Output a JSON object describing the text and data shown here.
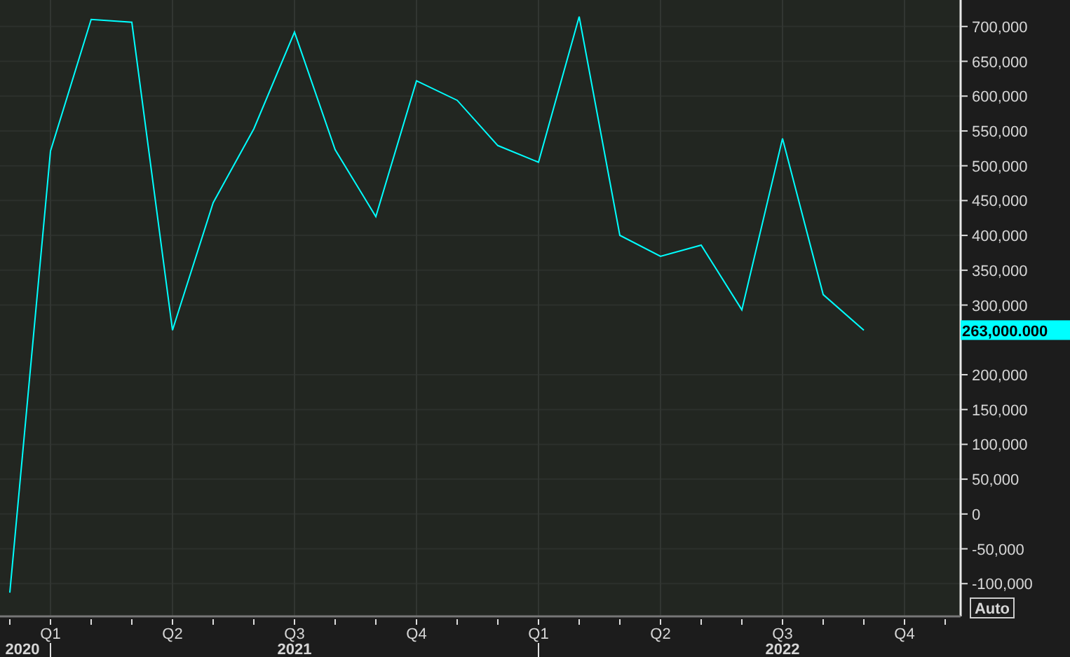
{
  "chart": {
    "chart_data": {
      "type": "line",
      "categories": [
        null,
        "Q1",
        null,
        null,
        "Q2",
        null,
        null,
        "Q3",
        null,
        null,
        "Q4",
        null,
        null,
        "Q1",
        null,
        null,
        "Q2",
        null,
        null,
        "Q3",
        null,
        null,
        "Q4"
      ],
      "series": [
        {
          "color": "#00ffff",
          "values": [
            -113000,
            521000,
            710000,
            706000,
            264000,
            447000,
            553000,
            692000,
            523000,
            427000,
            622000,
            594000,
            529000,
            505000,
            714000,
            400000,
            370000,
            386000,
            293000,
            539000,
            315000,
            264000,
            null
          ]
        }
      ],
      "ylim": [
        -147000,
        738000
      ],
      "grid": true,
      "yticks": [
        {
          "value": -100000,
          "label": "-100,000"
        },
        {
          "value": -50000,
          "label": "-50,000"
        },
        {
          "value": 0,
          "label": "0"
        },
        {
          "value": 50000,
          "label": "50,000"
        },
        {
          "value": 100000,
          "label": "100,000"
        },
        {
          "value": 150000,
          "label": "150,000"
        },
        {
          "value": 200000,
          "label": "200,000"
        },
        {
          "value": 300000,
          "label": "300,000"
        },
        {
          "value": 350000,
          "label": "350,000"
        },
        {
          "value": 400000,
          "label": "400,000"
        },
        {
          "value": 450000,
          "label": "450,000"
        },
        {
          "value": 500000,
          "label": "500,000"
        },
        {
          "value": 550000,
          "label": "550,000"
        },
        {
          "value": 600000,
          "label": "600,000"
        },
        {
          "value": 650000,
          "label": "650,000"
        },
        {
          "value": 700000,
          "label": "700,000"
        }
      ]
    },
    "years": [
      {
        "label": "2020"
      },
      {
        "label": "2021"
      },
      {
        "label": "2022"
      }
    ],
    "last_value": "263,000.000",
    "scale_button": "Auto"
  }
}
